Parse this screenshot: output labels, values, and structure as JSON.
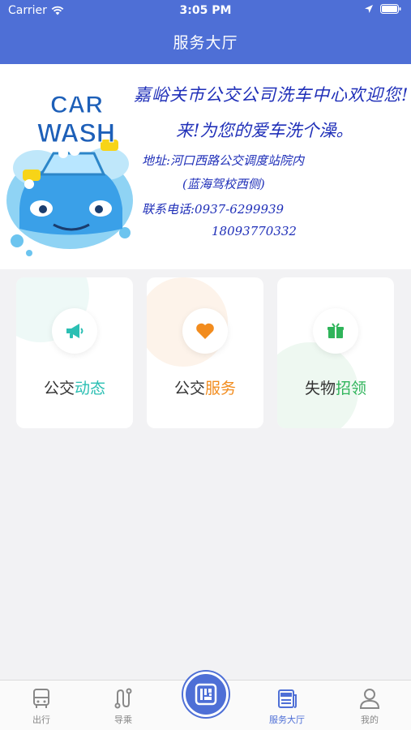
{
  "status_bar": {
    "carrier": "Carrier",
    "time": "3:05 PM"
  },
  "header": {
    "title": "服务大厅"
  },
  "banner": {
    "logo_text_1": "CAR",
    "logo_text_2": "WASH",
    "headline": "嘉峪关市公交公司洗车中心欢迎您!",
    "line2": "来!为您的爱车洗个澡。",
    "address": "地址:河口西路公交调度站院内",
    "address_note": "(蓝海驾校西侧)",
    "contact": "联系电话:0937-6299939",
    "phone2": "18093770332"
  },
  "services": [
    {
      "prefix": "公交",
      "highlight": "动态",
      "color": "#2bbfb3",
      "icon": "megaphone-icon"
    },
    {
      "prefix": "公交",
      "highlight": "服务",
      "color": "#f28c1e",
      "icon": "heart-icon"
    },
    {
      "prefix": "失物",
      "highlight": "招领",
      "color": "#2fb45a",
      "icon": "gift-box-icon"
    }
  ],
  "tabs": [
    {
      "label": "出行",
      "icon": "bus-icon"
    },
    {
      "label": "导乘",
      "icon": "route-icon"
    },
    {
      "label": "服务大厅",
      "icon": "news-icon",
      "active": true
    },
    {
      "label": "我的",
      "icon": "user-icon"
    }
  ],
  "center_button": {
    "icon": "qr-code-icon"
  },
  "colors": {
    "primary": "#4e6fd6",
    "background": "#f2f2f4"
  }
}
